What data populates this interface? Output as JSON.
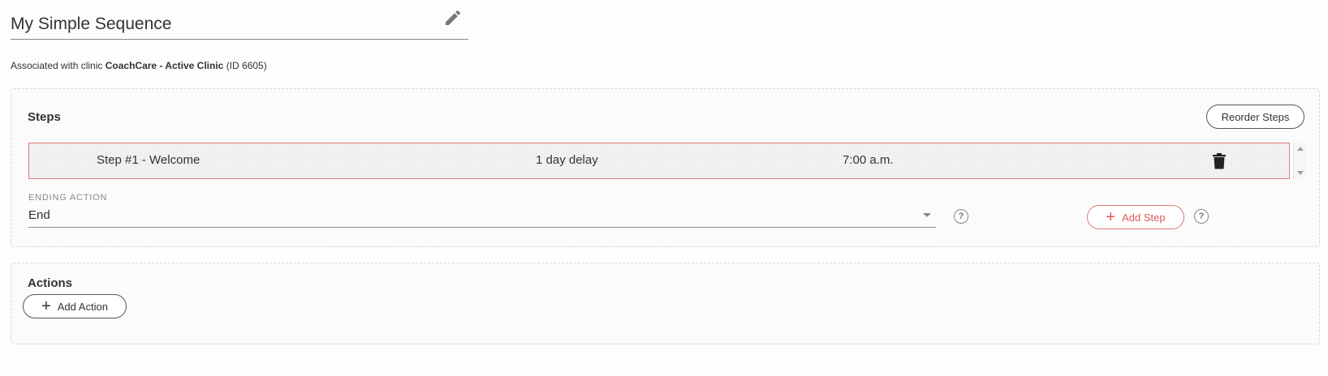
{
  "sequence": {
    "title": "My Simple Sequence",
    "assoc_prefix": "Associated with clinic",
    "clinic_name": "CoachCare - Active Clinic",
    "clinic_id_text": "(ID 6605)"
  },
  "steps_section": {
    "title": "Steps",
    "reorder_label": "Reorder Steps",
    "steps": [
      {
        "name": "Step #1 - Welcome",
        "delay": "1 day delay",
        "time": "7:00 a.m."
      }
    ],
    "ending_action_label": "ENDING ACTION",
    "ending_action_value": "End",
    "add_step_label": "Add Step",
    "help_glyph": "?"
  },
  "actions_section": {
    "title": "Actions",
    "add_action_label": "Add Action"
  },
  "colors": {
    "accent": "#e05a5a",
    "step_border": "#e0787a",
    "text": "#333333"
  },
  "icons": [
    "pencil-icon",
    "trash-icon",
    "help-icon",
    "plus-icon",
    "chevron-down-icon"
  ]
}
